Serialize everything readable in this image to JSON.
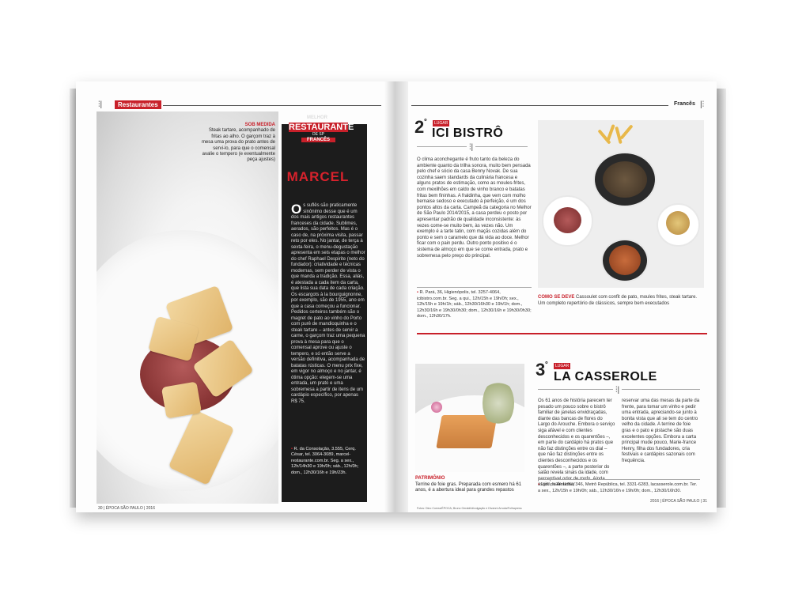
{
  "left_page": {
    "section": "Restaurantes",
    "photo_caption": {
      "kicker": "SOB MEDIDA",
      "text": "Steak tartare, acompanhado de fritas ao alho. O garçom traz à mesa uma prova do prato antes de servi-lo, para que o comensal avalie o tempero (e eventualmente peça ajustes)"
    },
    "award": {
      "top": "MELHOR",
      "badge_line1": "RESTAURANTE",
      "badge_line2": "DE SP",
      "badge_line3": "FRANCÊS",
      "name": "MARCEL",
      "dropcap": "O",
      "body": "s suflês são praticamente sinônimo desse que é um dos mais antigos restaurantes franceses da cidade. Sublimes, aerados, são perfeitos. Mas é o caso de, na próxima visita, passar reto por eles. No jantar, de terça à sexta-feira, o menu-degustação apresenta em seis etapas o melhor do chef Raphael Despirite (neto do fundador): criatividade e técnicas modernas, sem perder de vista o que manda a tradição. Essa, aliás, é atestada a cada item da carta, que lista sua data de cada criação. Os escargots à la bourguignonne, por exemplo, são de 1955, ano em que a casa começou a funcionar. Pedidos certeiros também são o magret de pato ao vinho do Porto com purê de mandioquinha e o steak tartare – antes de servir a carne, o garçom traz uma pequena prova à mesa para que o comensal aprove ou ajuste o tempero, e só então serve a versão definitiva, acompanhada de batatas rústicas. O menu prix fixe, em vigor no almoço e no jantar, é ótima opção: elegem-se uma entrada, um prato e uma sobremesa a partir de itens de um cardápio específico, por apenas R$ 75.",
      "address": "R. da Consolação, 3.555, Cerq. César, tel. 3064-3089, marcel-restaurante.com.br. Seg. a sex., 12h/14h30 e 19h/0h; sáb., 12h/0h; dom., 12h30/16h e 19h/23h."
    },
    "footer": "30 | ÉPOCA SÃO PAULO | 2016"
  },
  "right_page": {
    "section": "Francês",
    "ici": {
      "rank": "2",
      "rank_suffix": "º",
      "tag": "LUGAR",
      "name": "ICI BISTRÔ",
      "body": "O clima aconchegante é fruto tanto da beleza do ambiente quanto da trilha sonora, muito bem pensada pelo chef e sócio da casa Benny Novak. De sua cozinha saem standards da culinária francesa e alguns pratos de estimação, como as moules-frites, com mexilhões em caldo de vinho branco e batatas fritas bem fininhas. A fraldinha, que vem com molho bernaise sedoso e executado à perfeição, é um dos pontos altos da carta. Campeã da categoria no Melhor de São Paulo 2014/2015, a casa perdeu o posto por apresentar padrão de qualidade inconsistente: às vezes come-se muito bem, às vezes não. Um exemplo é a tarte tatin, com maçãs cozidas além do ponto e sem o caramelo que dá vida ao doce. Melhor ficar com o pain perdu. Outro ponto positivo é o sistema de almoço em que se come entrada, prato e sobremesa pelo preço do principal.",
      "address": "R. Pará, 36, Higienópolis, tel. 3257-4064, icibistro.com.br. Seg. a qui., 12h/15h e 19h/0h; sex., 12h/15h e 19h/1h; sáb., 12h30/16h30 e 19h/1h; dom., 12h30/16h e 19h30/0h30; dom., 12h30/16h e 19h30/0h30; dom., 12h30/17h.",
      "photo_caption_kicker": "COMO SE DEVE",
      "photo_caption": "Cassoulet com confit de pato, moules frites, steak tartare. Um completo repertório de clássicos, sempre bem executados"
    },
    "casserole": {
      "rank": "3",
      "rank_suffix": "º",
      "tag": "LUGAR",
      "name": "LA CASSEROLE",
      "body_col1": "Os 61 anos de história parecem ter pesado um pouco sobre o bistrô familiar de janelas envidraçadas, diante das bancas de flores do Largo do Arouche. Embora o serviço siga afável e com clientes desconhecidos e os quarentões –, em parte do cardápio há pratos que não faz distinções entre os dial – que não faz distinções entre os clientes desconhecidos e os quarentões –, a parte posterior do salão revela sinais da idade, com perceptível odor de mofo. Ainda assim, vale tentar",
      "body_col2": "reservar uma das mesas da parte da frente, para tomar um vinho e pedir uma entrada, apreciando-se junto à bonita vista que ali se tem do centro velho da cidade. A terrine de foie gras e o pato e pistache são duas excelentes opções. Embora a carta principal mude pouco, Marie-france Henry, filha dos fundadores, cria festivais e cardápios sazonais com frequência.",
      "address": "Lgo. do Arouche, 346, Metrô República, tel. 3331-6283, lacasserole.com.br. Ter. a sex., 12h/15h e 19h/0h; sáb., 12h30/16h e 19h/0h; dom., 12h30/16h30.",
      "photo_caption_kicker": "PATRIMÔNIO",
      "photo_caption": "Terrine de foie gras. Preparada com esmero há 61 anos, é a abertura ideal para grandes repastos"
    },
    "credits": "Fotos: Dino Correa/ÉPOCA; Bruno Geraldi/divulgação e Divanni Arruda/Folhapress",
    "footer": "2016 | ÉPOCA SÃO PAULO | 31"
  },
  "colors": {
    "accent": "#c8202a",
    "panel": "#1c1c1c"
  }
}
